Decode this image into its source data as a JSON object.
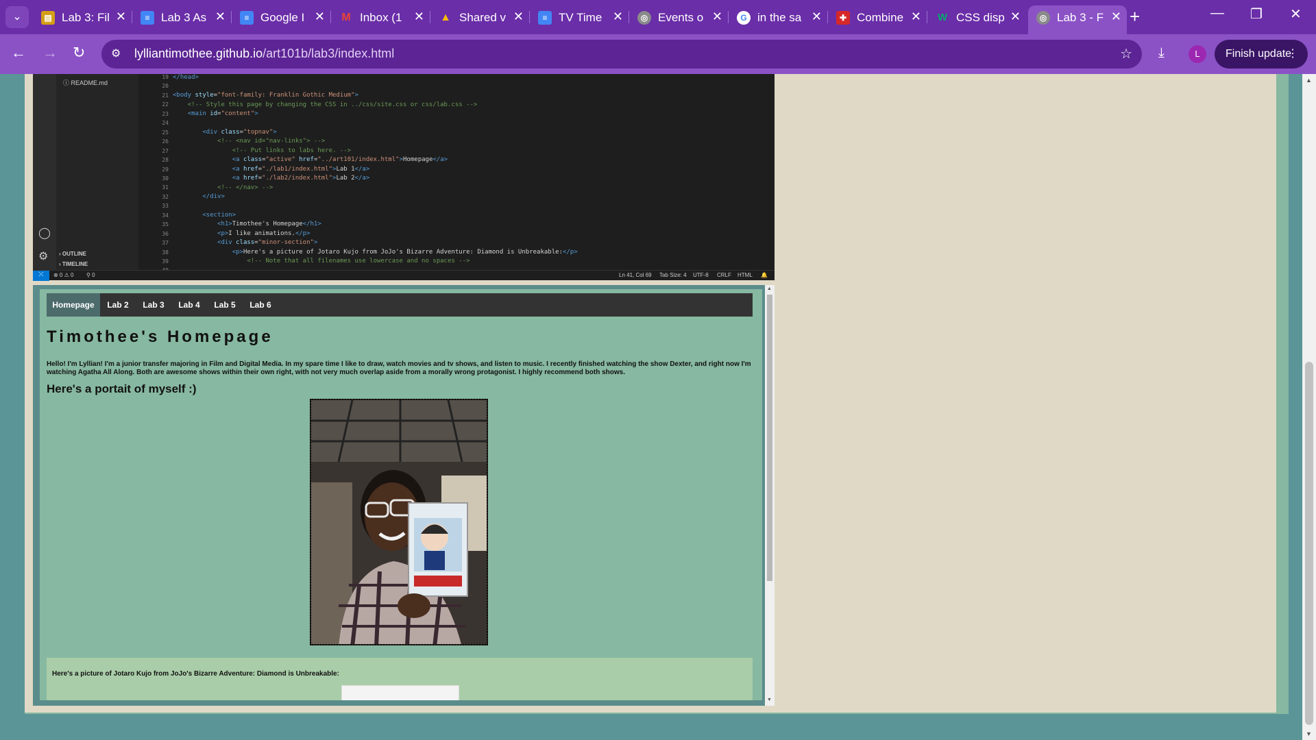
{
  "browser": {
    "tabs": [
      {
        "title": "Lab 3: Fil",
        "icon": "canvas-icon",
        "color": "#d4a017"
      },
      {
        "title": "Lab 3 As",
        "icon": "google-docs-icon",
        "color": "#4285f4"
      },
      {
        "title": "Google I",
        "icon": "google-docs-icon",
        "color": "#4285f4"
      },
      {
        "title": "Inbox (1",
        "icon": "gmail-icon",
        "color": "#ea4335"
      },
      {
        "title": "Shared v",
        "icon": "google-drive-icon",
        "color": "#34a853"
      },
      {
        "title": "TV Time",
        "icon": "google-docs-icon",
        "color": "#4285f4"
      },
      {
        "title": "Events o",
        "icon": "globe-icon",
        "color": "#8a8a8a"
      },
      {
        "title": "in the sa",
        "icon": "google-icon",
        "color": "#ffffff"
      },
      {
        "title": "Combine",
        "icon": "flag-icon",
        "color": "#d62828"
      },
      {
        "title": "CSS disp",
        "icon": "w3schools-icon",
        "color": "#04aa6d"
      },
      {
        "title": "Lab 3 - F",
        "icon": "globe-icon",
        "color": "#8a8a8a"
      }
    ],
    "url_host": "lylliantimothee.github.io",
    "url_path": "/art101b/lab3/index.html",
    "profile_initial": "L",
    "finish_update_label": "Finish update"
  },
  "vscode": {
    "explorer_file": "README.md",
    "outline_label": "OUTLINE",
    "timeline_label": "TIMELINE",
    "line_numbers": [
      "19",
      "20",
      "21",
      "22",
      "23",
      "24",
      "25",
      "26",
      "27",
      "28",
      "29",
      "30",
      "31",
      "32",
      "33",
      "34",
      "35",
      "36",
      "37",
      "38",
      "39",
      "40"
    ],
    "status": {
      "problems": "⊗ 0 ⚠ 0",
      "ports": "⚲ 0",
      "position": "Ln 41, Col 69",
      "tab_size": "Tab Size: 4",
      "encoding": "UTF-8",
      "eol": "CRLF",
      "language": "HTML"
    }
  },
  "preview": {
    "nav": [
      "Homepage",
      "Lab 2",
      "Lab 3",
      "Lab 4",
      "Lab 5",
      "Lab 6"
    ],
    "heading": "Timothee's Homepage",
    "intro": "Hello! I'm Lyllian! I'm a junior transfer majoring in Film and Digital Media. In my spare time I like to draw, watch movies and tv shows, and listen to music. I recently finished watching the show Dexter, and right now I'm watching Agatha All Along. Both are awesome shows within their own right, with not very much overlap aside from a morally wrong protagonist. I highly recommend both shows.",
    "subheading": "Here's a portait of myself :)",
    "minor_section_text": "Here's a picture of Jotaro Kujo from JoJo's Bizarre Adventure: Diamond is Unbreakable:"
  }
}
